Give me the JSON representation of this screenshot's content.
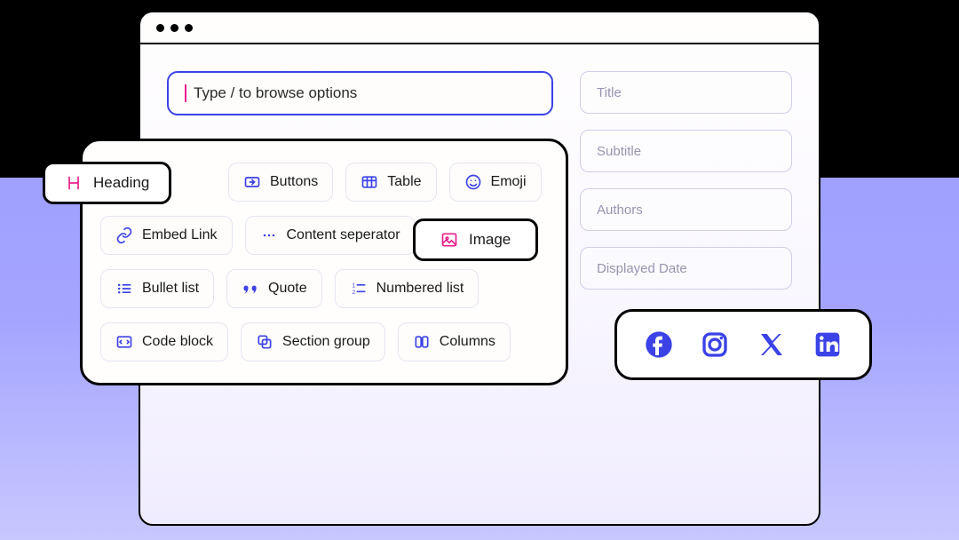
{
  "search": {
    "placeholder": "Type / to browse options"
  },
  "meta_fields": {
    "title": "Title",
    "subtitle": "Subtitle",
    "authors": "Authors",
    "displayed_date": "Displayed Date"
  },
  "highlighted": {
    "heading": "Heading",
    "image": "Image"
  },
  "options": {
    "row1": {
      "buttons": "Buttons",
      "table": "Table",
      "emoji": "Emoji"
    },
    "row2": {
      "embed_link": "Embed Link",
      "content_separator": "Content seperator"
    },
    "row3": {
      "bullet_list": "Bullet list",
      "quote": "Quote",
      "numbered_list": "Numbered list"
    },
    "row4": {
      "code_block": "Code block",
      "section_group": "Section group",
      "columns": "Columns"
    }
  }
}
